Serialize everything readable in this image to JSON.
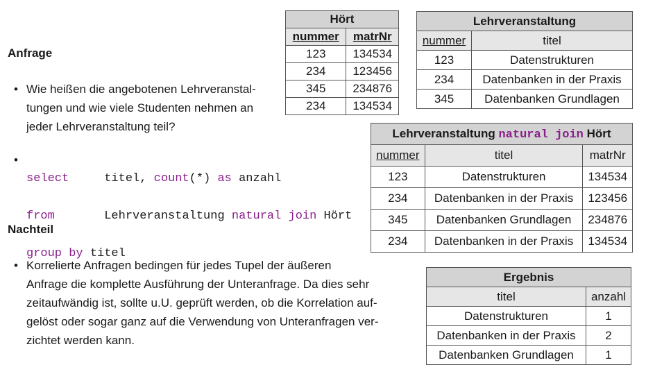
{
  "anfrage": {
    "heading": "Anfrage",
    "bullet1": [
      "Wie heißen die angebotenen Lehrveranstal-",
      "tungen und wie viele Studenten nehmen an",
      "jeder Lehrveranstaltung teil?"
    ],
    "sql": {
      "l1_kw": "select",
      "l1_rest1": "titel, ",
      "l1_fn": "count",
      "l1_rest2": "(*) ",
      "l1_as": "as",
      "l1_rest3": " anzahl",
      "l2_kw": "from",
      "l2_rest1": "Lehrveranstaltung ",
      "l2_nj": "natural join",
      "l2_rest2": " Hört",
      "l3_kw": "group by",
      "l3_rest": " titel"
    }
  },
  "nachteil": {
    "heading": "Nachteil",
    "lines": [
      "Korrelierte Anfragen bedingen für jedes Tupel der äußeren",
      "Anfrage die komplette Ausführung der Unteranfrage. Da dies sehr",
      "zeitaufwändig ist, sollte u.U. geprüft werden, ob die Korrelation auf-",
      "gelöst oder sogar ganz auf die Verwendung von Unteranfragen ver-",
      "zichtet werden kann."
    ]
  },
  "bullet": "•",
  "hoert": {
    "title": "Hört",
    "cols": [
      "nummer",
      "matrNr"
    ],
    "rows": [
      [
        "123",
        "134534"
      ],
      [
        "234",
        "123456"
      ],
      [
        "345",
        "234876"
      ],
      [
        "234",
        "134534"
      ]
    ]
  },
  "lv": {
    "title": "Lehrveranstaltung",
    "cols": [
      "nummer",
      "titel"
    ],
    "rows": [
      [
        "123",
        "Datenstrukturen"
      ],
      [
        "234",
        "Datenbanken in der Praxis"
      ],
      [
        "345",
        "Datenbanken Grundlagen"
      ]
    ]
  },
  "nj": {
    "title_a": "Lehrveranstaltung ",
    "title_kw": "natural join",
    "title_b": " Hört",
    "cols": [
      "nummer",
      "titel",
      "matrNr"
    ],
    "rows": [
      [
        "123",
        "Datenstrukturen",
        "134534"
      ],
      [
        "234",
        "Datenbanken in der Praxis",
        "123456"
      ],
      [
        "345",
        "Datenbanken Grundlagen",
        "234876"
      ],
      [
        "234",
        "Datenbanken in der Praxis",
        "134534"
      ]
    ]
  },
  "ergebnis": {
    "title": "Ergebnis",
    "cols": [
      "titel",
      "anzahl"
    ],
    "rows": [
      [
        "Datenstrukturen",
        "1"
      ],
      [
        "Datenbanken in der Praxis",
        "2"
      ],
      [
        "Datenbanken Grundlagen",
        "1"
      ]
    ]
  }
}
